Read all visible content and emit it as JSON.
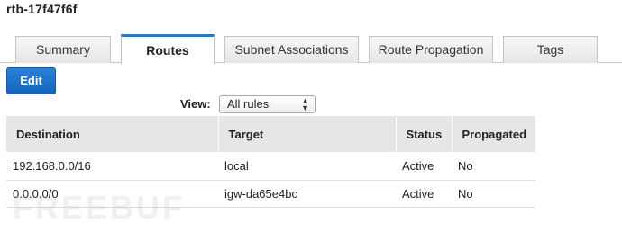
{
  "title": "rtb-17f47f6f",
  "tabs": [
    {
      "label": "Summary",
      "active": false
    },
    {
      "label": "Routes",
      "active": true
    },
    {
      "label": "Subnet Associations",
      "active": false
    },
    {
      "label": "Route Propagation",
      "active": false
    },
    {
      "label": "Tags",
      "active": false
    }
  ],
  "toolbar": {
    "edit_label": "Edit"
  },
  "view": {
    "label": "View:",
    "selected": "All rules"
  },
  "table": {
    "headers": [
      "Destination",
      "Target",
      "Status",
      "Propagated"
    ],
    "rows": [
      {
        "destination": "192.168.0.0/16",
        "target": "local",
        "status": "Active",
        "propagated": "No"
      },
      {
        "destination": "0.0.0.0/0",
        "target": "igw-da65e4bc",
        "status": "Active",
        "propagated": "No"
      }
    ]
  },
  "watermark": "FREEBUF",
  "colors": {
    "accent": "#1f7ad1",
    "button": "#1465b8",
    "status_active": "#1a9a1a",
    "link": "#1f6fb9"
  }
}
